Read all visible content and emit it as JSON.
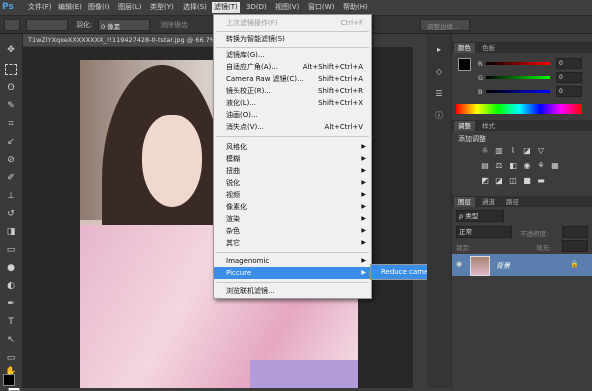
{
  "app": {
    "logo": "Ps"
  },
  "menubar": {
    "items": [
      "文件(F)",
      "编辑(E)",
      "图像(I)",
      "图层(L)",
      "类型(Y)",
      "选择(S)",
      "滤镜(T)",
      "3D(D)",
      "视图(V)",
      "窗口(W)",
      "帮助(H)"
    ],
    "active_index": 6
  },
  "options": {
    "feather_label": "羽化:",
    "feather_value": "0 像素",
    "antialias_label": "消除锯齿",
    "refine_edge": "调整边缘..."
  },
  "document": {
    "tab_title": "T1wZlYXqxeXXXXXXXX_!!119427428-0-tstar.jpg @ 66.7%(R"
  },
  "filter_menu": {
    "last_filter": {
      "label": "上次滤镜操作(F)",
      "shortcut": "Ctrl+F"
    },
    "smart": "转换为智能滤镜(S)",
    "group1": [
      {
        "label": "滤镜库(G)...",
        "shortcut": ""
      },
      {
        "label": "自适应广角(A)...",
        "shortcut": "Alt+Shift+Ctrl+A"
      },
      {
        "label": "Camera Raw 滤镜(C)...",
        "shortcut": "Shift+Ctrl+A"
      },
      {
        "label": "镜头校正(R)...",
        "shortcut": "Shift+Ctrl+R"
      },
      {
        "label": "液化(L)...",
        "shortcut": "Shift+Ctrl+X"
      },
      {
        "label": "油画(O)...",
        "shortcut": ""
      },
      {
        "label": "消失点(V)...",
        "shortcut": "Alt+Ctrl+V"
      }
    ],
    "group2": [
      "风格化",
      "模糊",
      "扭曲",
      "锐化",
      "视频",
      "像素化",
      "渲染",
      "杂色",
      "其它"
    ],
    "group3": [
      "Imagenomic",
      "Piccure"
    ],
    "browse": "浏览联机滤镜..."
  },
  "submenu": {
    "item": "Reduce camera shake..."
  },
  "color_panel": {
    "tabs": [
      "颜色",
      "色板"
    ],
    "r_label": "R",
    "g_label": "G",
    "b_label": "B",
    "r_value": "0",
    "g_value": "0",
    "b_value": "0"
  },
  "adjust_panel": {
    "tabs": [
      "调整",
      "样式"
    ],
    "add_label": "添加调整"
  },
  "layers_panel": {
    "tabs": [
      "图层",
      "通道",
      "路径"
    ],
    "kind_label": "ρ 类型",
    "blend_mode": "正常",
    "opacity_label": "不透明度:",
    "lock_label": "锁定:",
    "fill_label": "填充:",
    "layer_name": "背景"
  },
  "colors": {
    "accent": "#3b8ee8",
    "layer_selected": "#5a7fae"
  }
}
